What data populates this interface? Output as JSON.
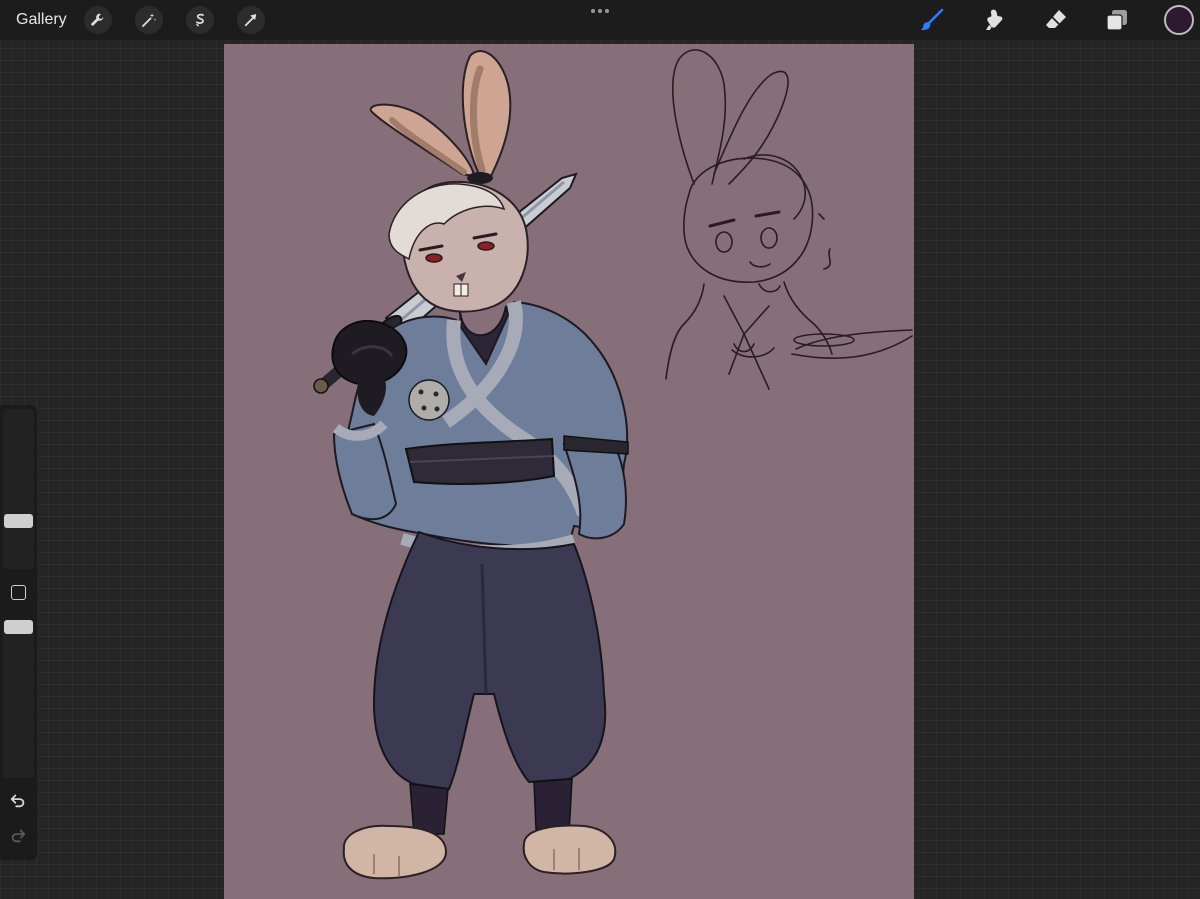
{
  "topbar": {
    "gallery_label": "Gallery",
    "left_tools": [
      "wrench-icon",
      "magic-wand-icon",
      "selection-icon",
      "transform-arrow-icon"
    ],
    "more_icon": "more-dots-icon",
    "right_tools": [
      "brush-icon",
      "smudge-icon",
      "eraser-icon",
      "layers-icon"
    ],
    "active_tool": "brush",
    "active_tool_color": "#2f7cf6",
    "current_color": "#2e1a2e"
  },
  "canvas": {
    "background_color": "#876f79"
  },
  "sidebar": {
    "brush_size_level": 0.28,
    "opacity_level": 1.0,
    "icons": [
      "modify-square-icon",
      "undo-icon",
      "redo-icon"
    ]
  }
}
